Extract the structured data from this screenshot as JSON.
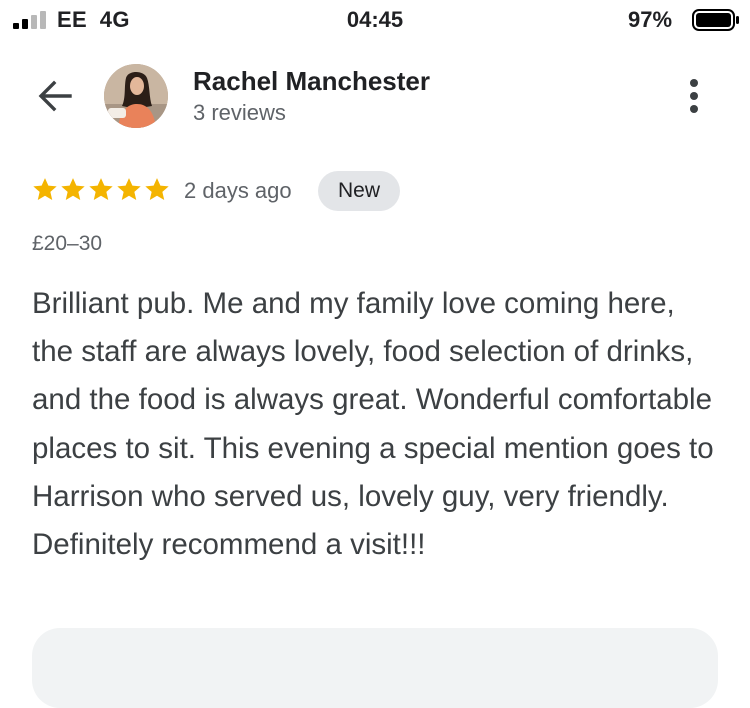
{
  "status_bar": {
    "carrier": "EE",
    "network": "4G",
    "time": "04:45",
    "battery_percent": "97%"
  },
  "header": {
    "reviewer_name": "Rachel Manchester",
    "review_count": "3 reviews",
    "back_icon": "arrow-back-icon",
    "more_icon": "more-vert-icon"
  },
  "review": {
    "stars": 5,
    "date": "2 days ago",
    "badge": "New",
    "price_range": "£20–30",
    "text": "Brilliant pub. Me and my family love coming here, the staff are always lovely, food selection of drinks, and the food is always great. Wonderful comfortable places to sit. This evening a special mention goes to Harrison who served us, lovely guy, very friendly. Definitely recommend a visit!!!"
  },
  "colors": {
    "star": "#F4B400",
    "badge_bg": "#E3E5E8",
    "secondary_text": "#5F6368",
    "body_text": "#3C4043"
  }
}
